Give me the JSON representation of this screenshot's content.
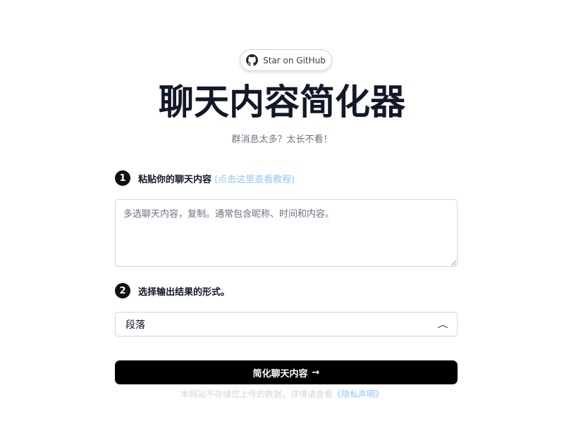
{
  "header": {
    "star_label": "Star on GitHub",
    "title": "聊天内容简化器",
    "subtitle": "群消息太多？太长不看！"
  },
  "step1": {
    "number": "1",
    "label": "粘贴你的聊天内容",
    "tutorial_link": "(点击这里查看教程)",
    "textarea_placeholder": "多选聊天内容，复制。通常包含昵称、时间和内容。",
    "textarea_value": ""
  },
  "step2": {
    "number": "2",
    "label": "选择输出结果的形式。",
    "selected_option": "段落",
    "chevron_icon": "chevron-up-icon"
  },
  "submit": {
    "label": "简化聊天内容",
    "arrow": "→"
  },
  "footer": {
    "note": "本网站不存储您上传的数据，详情请查看",
    "privacy_link": "《隐私声明》"
  },
  "colors": {
    "button_bg": "#000000",
    "link": "#93c5fd",
    "muted_text": "#6b7280"
  }
}
